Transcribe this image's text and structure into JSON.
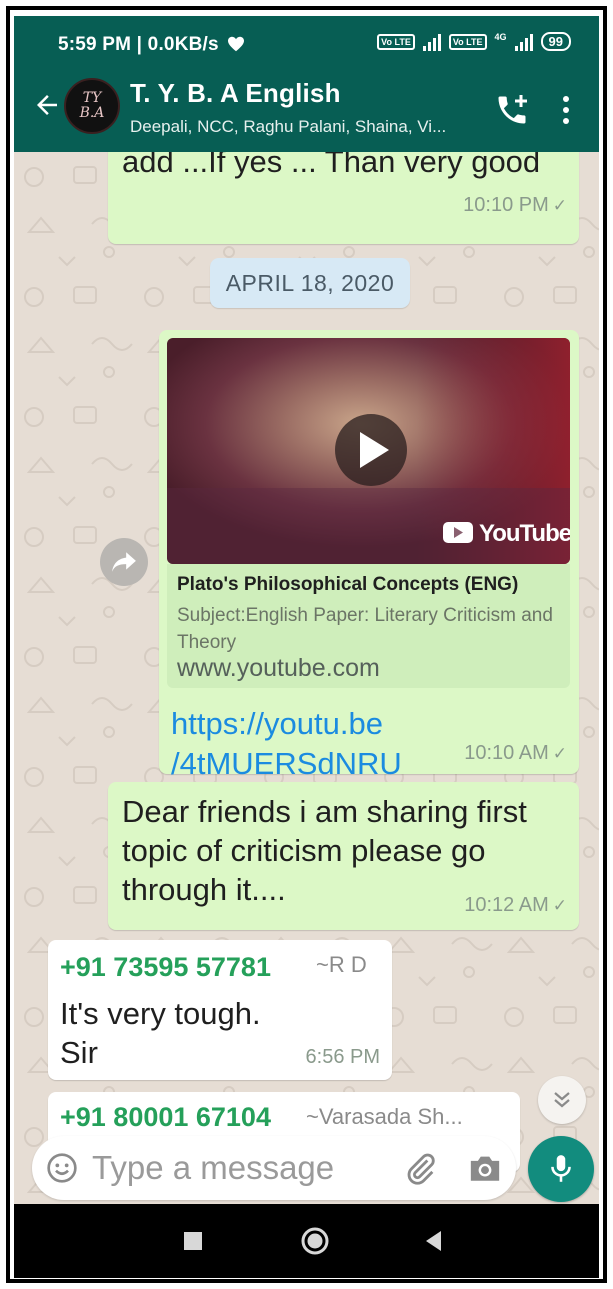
{
  "status_bar": {
    "time_speed": "5:59 PM | 0.0KB/s",
    "volte_1": "Vo LTE",
    "volte_2": "Vo LTE",
    "network": "4G",
    "battery": "99"
  },
  "header": {
    "avatar_text_line1": "TY",
    "avatar_text_line2": "B.A",
    "title": "T. Y. B. A English",
    "subtitle": "Deepali, NCC, Raghu Palani, Shaina, Vi..."
  },
  "messages": {
    "m1": {
      "text": "add ...If yes ... Than very good",
      "time": "10:10 PM"
    },
    "date_divider": "APRIL 18, 2020",
    "m2": {
      "video_brand": "YouTube",
      "preview_title": "Plato's Philosophical Concepts (ENG)",
      "preview_description": "Subject:English Paper: Literary Criticism and Theory",
      "preview_domain": "www.youtube.com",
      "link_line1": "https://youtu.be",
      "link_line2": "/4tMUERSdNRU",
      "time": "10:10 AM"
    },
    "m3": {
      "line1": "Dear friends i am sharing first",
      "line2": "topic of criticism please go",
      "line3": "through it....",
      "time": "10:12 AM"
    },
    "m4": {
      "sender": "+91 73595 57781",
      "alias": "~R D",
      "line1": "It's very tough.",
      "line2": "Sir",
      "time": "6:56 PM"
    },
    "m5": {
      "sender": "+91 80001 67104",
      "alias": "~Varasada Sh..."
    }
  },
  "composer": {
    "placeholder": "Type a message"
  },
  "colors": {
    "header": "#075e54",
    "outgoing_bubble": "#dcf8c6",
    "incoming_bubble": "#ffffff",
    "chat_background": "#e6ddd4",
    "link": "#1b8be0",
    "sender_name": "#25a05a",
    "mic_button": "#128c7e"
  },
  "icons": {
    "status": [
      "heart-icon",
      "signal-icon",
      "battery-icon"
    ],
    "header": [
      "back-arrow-icon",
      "add-call-icon",
      "more-vert-icon"
    ],
    "chat": [
      "play-icon",
      "youtube-icon",
      "forward-icon",
      "double-chevron-down-icon"
    ],
    "composer": [
      "emoji-icon",
      "attach-icon",
      "camera-icon",
      "mic-icon"
    ],
    "nav": [
      "recents-icon",
      "home-icon",
      "back-icon"
    ]
  }
}
